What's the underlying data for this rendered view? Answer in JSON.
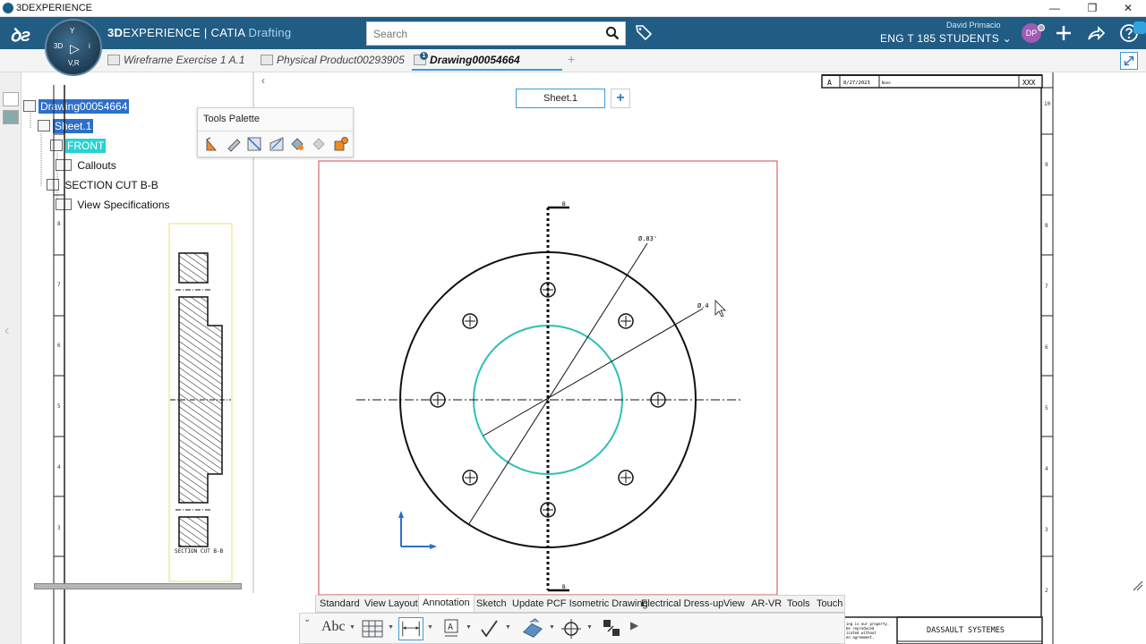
{
  "os": {
    "title": "3DEXPERIENCE"
  },
  "header": {
    "brand_bold": "3D",
    "brand_rest": "EXPERIENCE | CATIA",
    "app_name": "Drafting",
    "search_placeholder": "Search",
    "user_name": "David Primacio",
    "collab_space": "ENG T 185 STUDENTS",
    "avatar_initials": "DP",
    "compass": {
      "label_3d": "3D",
      "label_vr": "V,R",
      "label_i": "i",
      "label_y": "Y"
    }
  },
  "tabs": [
    {
      "label": "Wireframe Exercise 1 A.1",
      "badge": ""
    },
    {
      "label": "Physical Product00293905",
      "badge": ""
    },
    {
      "label": "Drawing00054664",
      "badge": "1",
      "active": true
    }
  ],
  "tree": {
    "root": "Drawing00054664",
    "sheet": "Sheet.1",
    "front": "FRONT",
    "callouts": "Callouts",
    "section": "SECTION CUT B-B",
    "view_specs": "View Specifications"
  },
  "tools_palette": {
    "title": "Tools Palette"
  },
  "sheet": {
    "tab_label": "Sheet.1",
    "add_label": "+",
    "section_caption": "SECTION CUT B-B",
    "dim_large": "Ø.83'",
    "dim_small": "Ø.4",
    "section_marker": "B",
    "title_block": {
      "rev": "A",
      "date": "8/27/2023",
      "desc": "None",
      "code": "XXX",
      "company": "DASSAULT SYSTEMES",
      "note_lines": [
        "ing is our property.",
        "be reproduced",
        "icated without",
        "en agreement."
      ]
    },
    "left_ruler": [
      "8",
      "7",
      "6",
      "5",
      "4",
      "3"
    ],
    "right_ruler": [
      "10",
      "9",
      "8",
      "7",
      "6",
      "5",
      "4",
      "3",
      "2"
    ]
  },
  "ribbon": {
    "tabs": [
      "Standard",
      "View Layout",
      "Annotation",
      "Sketch",
      "Update PCF Isometric Drawing",
      "Electrical Dress-up",
      "View",
      "AR-VR",
      "Tools",
      "Touch"
    ],
    "active_tab": "Annotation",
    "text_tool_label": "Abc"
  },
  "colors": {
    "header": "#215c85",
    "accent": "#3a9bd5",
    "selection": "#2d6fc9",
    "cyan_circle": "#2fbfb5",
    "view_frame_red": "#d34a4a",
    "view_frame_yellow": "#e8e070"
  }
}
